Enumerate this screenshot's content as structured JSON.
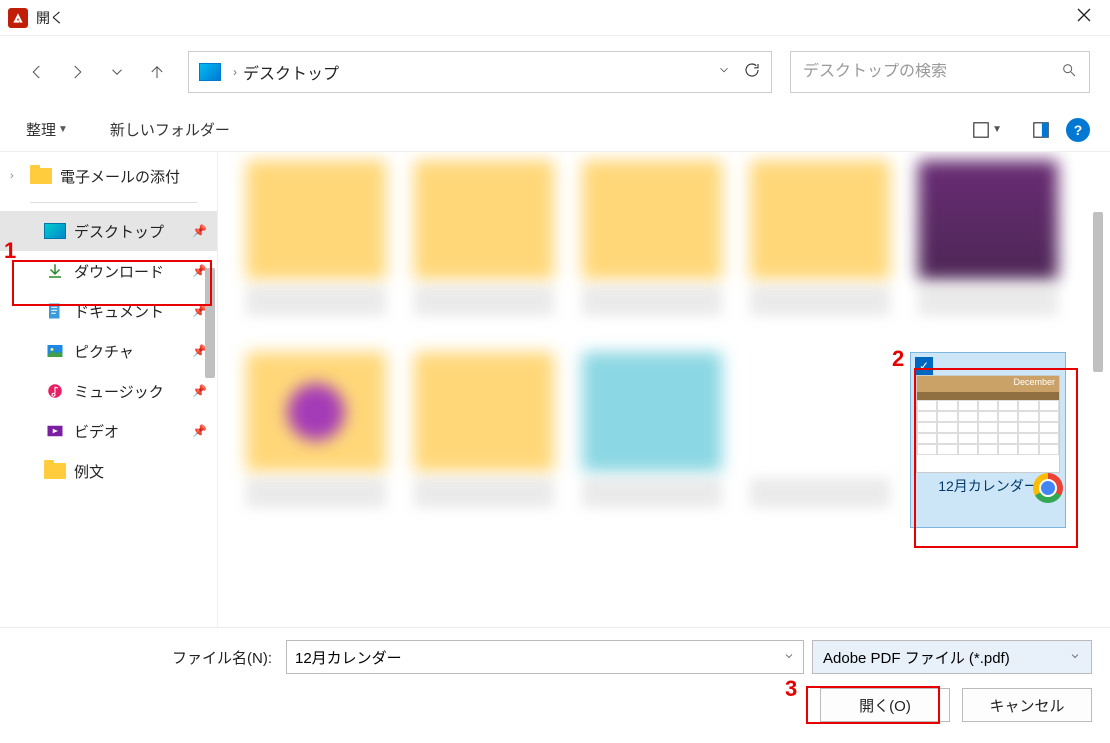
{
  "window": {
    "title": "開く"
  },
  "nav": {
    "path": "デスクトップ"
  },
  "search": {
    "placeholder": "デスクトップの検索"
  },
  "toolbar": {
    "organize": "整理",
    "newFolder": "新しいフォルダー"
  },
  "sidebar": {
    "topItem": "電子メールの添付",
    "items": [
      {
        "label": "デスクトップ"
      },
      {
        "label": "ダウンロード"
      },
      {
        "label": "ドキュメント"
      },
      {
        "label": "ピクチャ"
      },
      {
        "label": "ミュージック"
      },
      {
        "label": "ビデオ"
      },
      {
        "label": "例文"
      }
    ]
  },
  "selectedFile": {
    "name": "12月カレンダー",
    "previewMonth": "December"
  },
  "bottom": {
    "filenameLabel": "ファイル名(N):",
    "filenameValue": "12月カレンダー",
    "filterLabel": "Adobe PDF ファイル (*.pdf)",
    "openLabel": "開く(O)",
    "cancelLabel": "キャンセル"
  },
  "annotations": {
    "a1": "1",
    "a2": "2",
    "a3": "3"
  }
}
